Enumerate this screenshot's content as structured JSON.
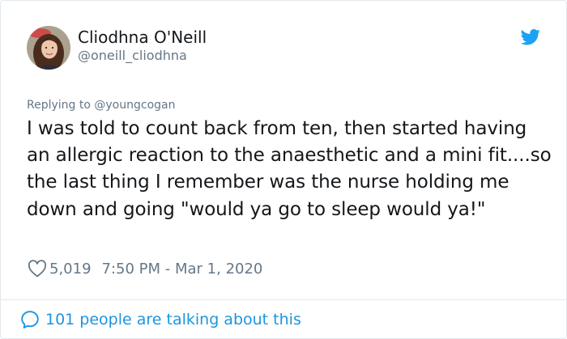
{
  "tweet": {
    "author": {
      "name": "Cliodhna O'Neill",
      "handle": "@oneill_cliodhna"
    },
    "replying_to_prefix": "Replying to ",
    "replying_to_user": "@youngcogan",
    "text": "I was told to count back from ten, then started having an allergic reaction to the anaesthetic and a mini fit....so the last thing I remember was the nurse holding me down and going \"would ya go to sleep would ya!\"",
    "likes": "5,019",
    "timestamp": "7:50 PM - Mar 1, 2020",
    "conversation_label": "101 people are talking about this"
  },
  "icons": {
    "brand": "twitter-bird-icon",
    "like": "heart-icon",
    "conversation": "speech-bubble-icon"
  },
  "colors": {
    "brand_blue": "#1da1f2",
    "link_blue": "#1b95e0",
    "text": "#14171a",
    "secondary_text": "#657786",
    "border": "#e1e8ed"
  }
}
